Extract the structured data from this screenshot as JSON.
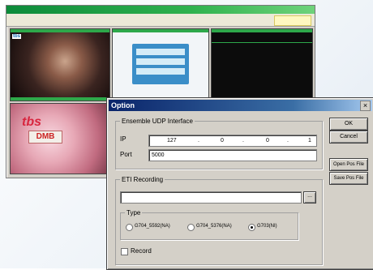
{
  "background_window": {
    "title": "",
    "badge": ""
  },
  "dialog": {
    "title": "Option",
    "close_glyph": "×",
    "udp_group": {
      "label": "Ensemble UDP Interface",
      "ip_label": "IP",
      "ip_octets": [
        "127",
        "0",
        "0",
        "1"
      ],
      "port_label": "Port",
      "port_value": "5000"
    },
    "eti_group": {
      "label": "ETI Recording",
      "path_value": "",
      "browse_label": "...",
      "type_group": {
        "label": "Type",
        "options": [
          {
            "label": "G704_5592(NA)",
            "selected": false
          },
          {
            "label": "G704_5376(NA)",
            "selected": false
          },
          {
            "label": "G703(NI)",
            "selected": true
          }
        ]
      },
      "record_label": "Record",
      "record_checked": false
    },
    "buttons": {
      "ok": "OK",
      "cancel": "Cancel",
      "open_pos": "Open Pos File",
      "save_pos": "Save Pos File"
    }
  },
  "tiles": {
    "tv4_text": "DMB"
  },
  "colors": {
    "title_bar": "#0a246a",
    "bg_title_bar": "#0c8a3a",
    "dialog_face": "#d4d0c8"
  }
}
